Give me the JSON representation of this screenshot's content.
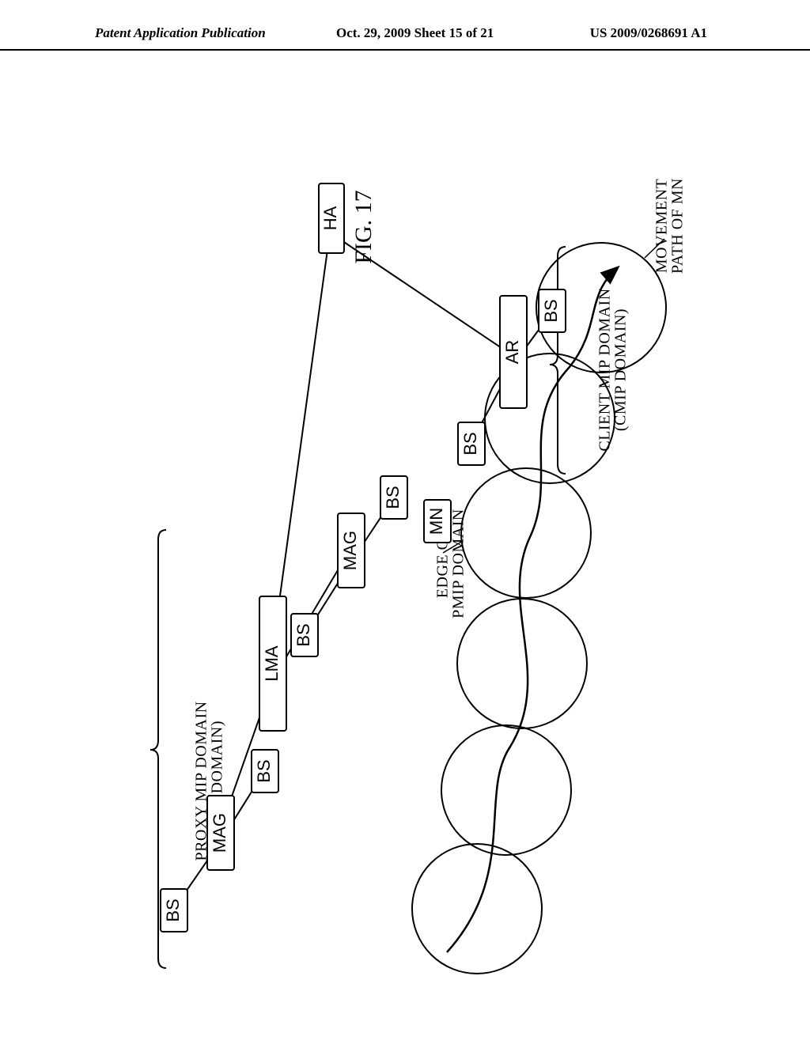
{
  "header": {
    "left": "Patent Application Publication",
    "center": "Oct. 29, 2009  Sheet 15 of 21",
    "right": "US 2009/0268691 A1"
  },
  "figure": {
    "label": "FIG. 17",
    "nodes": {
      "HA": "HA",
      "LMA": "LMA",
      "AR": "AR",
      "MAG": "MAG",
      "BS": "BS",
      "MN": "MN"
    },
    "domains": {
      "pmip_line1": "PROXY MIP DOMAIN",
      "pmip_line2": "(PMIP DOMAIN)",
      "edge_line1": "EDGE OF",
      "edge_line2": "PMIP DOMAIN",
      "cmip_line1": "CLIENT MIP DOMAIN",
      "cmip_line2": "(CMIP DOMAIN)"
    },
    "movement": {
      "line1": "MOVEMENT",
      "line2": "PATH OF MN"
    }
  },
  "chart_data": {
    "type": "diagram",
    "title": "FIG. 17",
    "elements": [
      "HA",
      "LMA",
      "AR",
      "MAG",
      "MAG",
      "BS",
      "BS",
      "BS",
      "BS",
      "BS",
      "BS",
      "MN"
    ],
    "edges": [
      [
        "HA",
        "LMA"
      ],
      [
        "HA",
        "AR"
      ],
      [
        "LMA",
        "MAG"
      ],
      [
        "LMA",
        "MAG"
      ],
      [
        "MAG",
        "BS"
      ],
      [
        "MAG",
        "BS"
      ],
      [
        "MAG",
        "BS"
      ],
      [
        "MAG",
        "BS"
      ],
      [
        "AR",
        "BS"
      ],
      [
        "AR",
        "BS"
      ]
    ],
    "annotations": [
      "PROXY MIP DOMAIN (PMIP DOMAIN)",
      "EDGE OF PMIP DOMAIN",
      "CLIENT MIP DOMAIN (CMIP DOMAIN)",
      "MOVEMENT PATH OF MN"
    ]
  }
}
